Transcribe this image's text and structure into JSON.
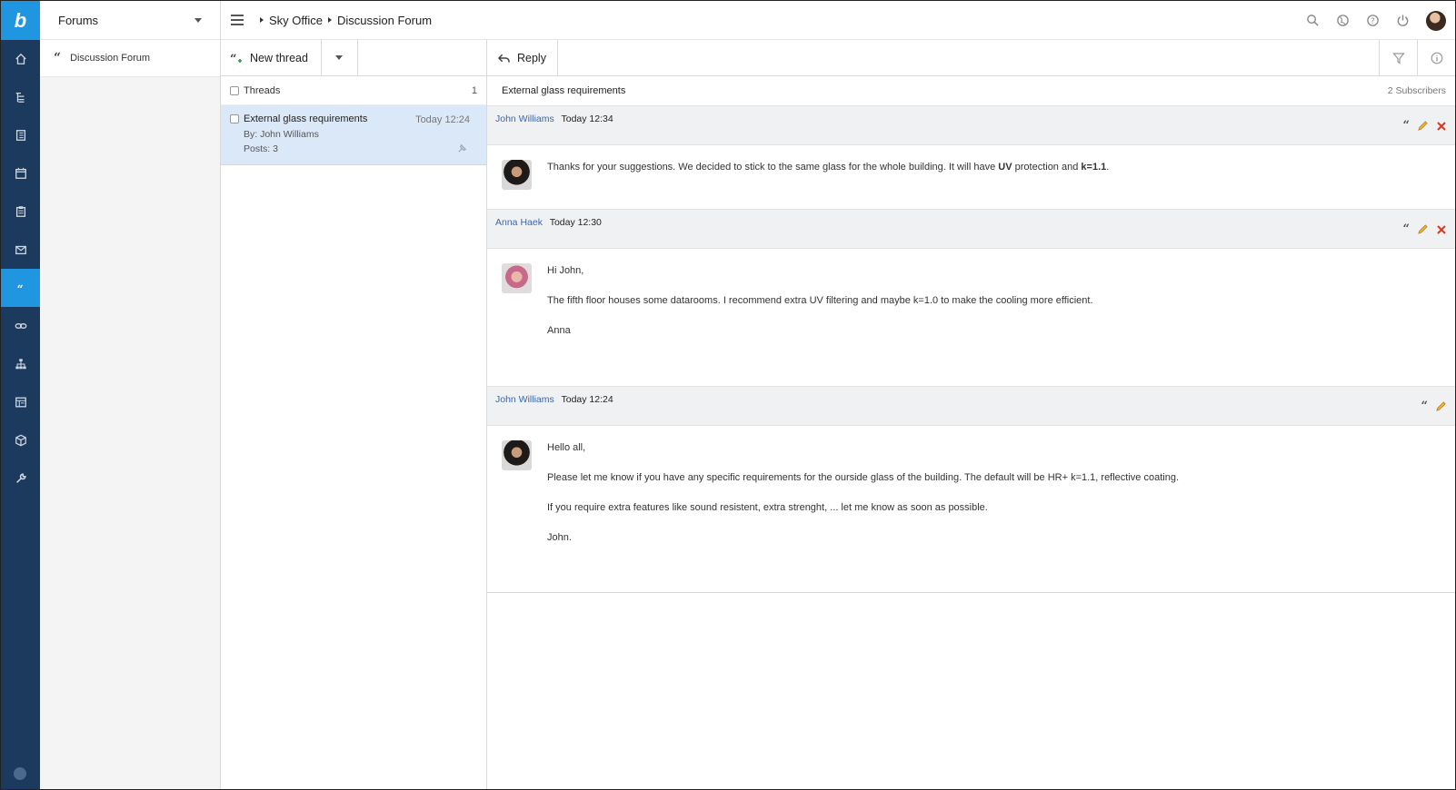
{
  "app": {
    "logo_glyph": "b",
    "rail": [
      {
        "name": "home-icon",
        "active": false
      },
      {
        "name": "tree-icon",
        "active": false
      },
      {
        "name": "contacts-icon",
        "active": false
      },
      {
        "name": "calendar-icon",
        "active": false
      },
      {
        "name": "clipboard-icon",
        "active": false
      },
      {
        "name": "mail-icon",
        "active": false
      },
      {
        "name": "forum-quote-icon",
        "active": true
      },
      {
        "name": "link-icon",
        "active": false
      },
      {
        "name": "hierarchy-icon",
        "active": false
      },
      {
        "name": "checklist-icon",
        "active": false
      },
      {
        "name": "package-icon",
        "active": false
      },
      {
        "name": "wrench-icon",
        "active": false
      }
    ],
    "accent": "#2196e0",
    "rail_color": "#1c3a5e"
  },
  "forums": {
    "title": "Forums",
    "items": [
      {
        "label": "Discussion Forum"
      }
    ]
  },
  "topbar": {
    "breadcrumb": [
      "Sky Office",
      "Discussion Forum"
    ]
  },
  "threads": {
    "new_thread_label": "New thread",
    "header_label": "Threads",
    "count": "1",
    "items": [
      {
        "title": "External glass requirements",
        "time": "Today 12:24",
        "by": "By: John Williams",
        "posts": "Posts: 3"
      }
    ]
  },
  "messages": {
    "reply_label": "Reply",
    "subject": "External glass requirements",
    "subscribers": "2 Subscribers",
    "posts": [
      {
        "author": "John Williams",
        "time": "Today 12:34",
        "avatar": "john",
        "lines": [],
        "line1_pre": "Thanks for your suggestions. We decided to stick to the same glass for the whole building. It will have ",
        "line1_b1": "UV",
        "line1_mid": " protection and ",
        "line1_b2": "k=1.1",
        "line1_end": "."
      },
      {
        "author": "Anna Haek",
        "time": "Today 12:30",
        "avatar": "anna",
        "lines": [
          "Hi John,",
          "The fifth floor houses some datarooms. I recommend extra UV filtering and maybe k=1.0 to make the cooling more efficient.",
          "Anna"
        ]
      },
      {
        "author": "John Williams",
        "time": "Today 12:24",
        "avatar": "john",
        "lines": [
          "Hello all,",
          "Please let me know if you have any specific requirements for the ourside glass of the building. The default will be HR+ k=1.1, reflective coating.",
          "If you require extra features like sound resistent, extra strenght, ... let me know as soon as possible.",
          "John."
        ]
      }
    ]
  }
}
